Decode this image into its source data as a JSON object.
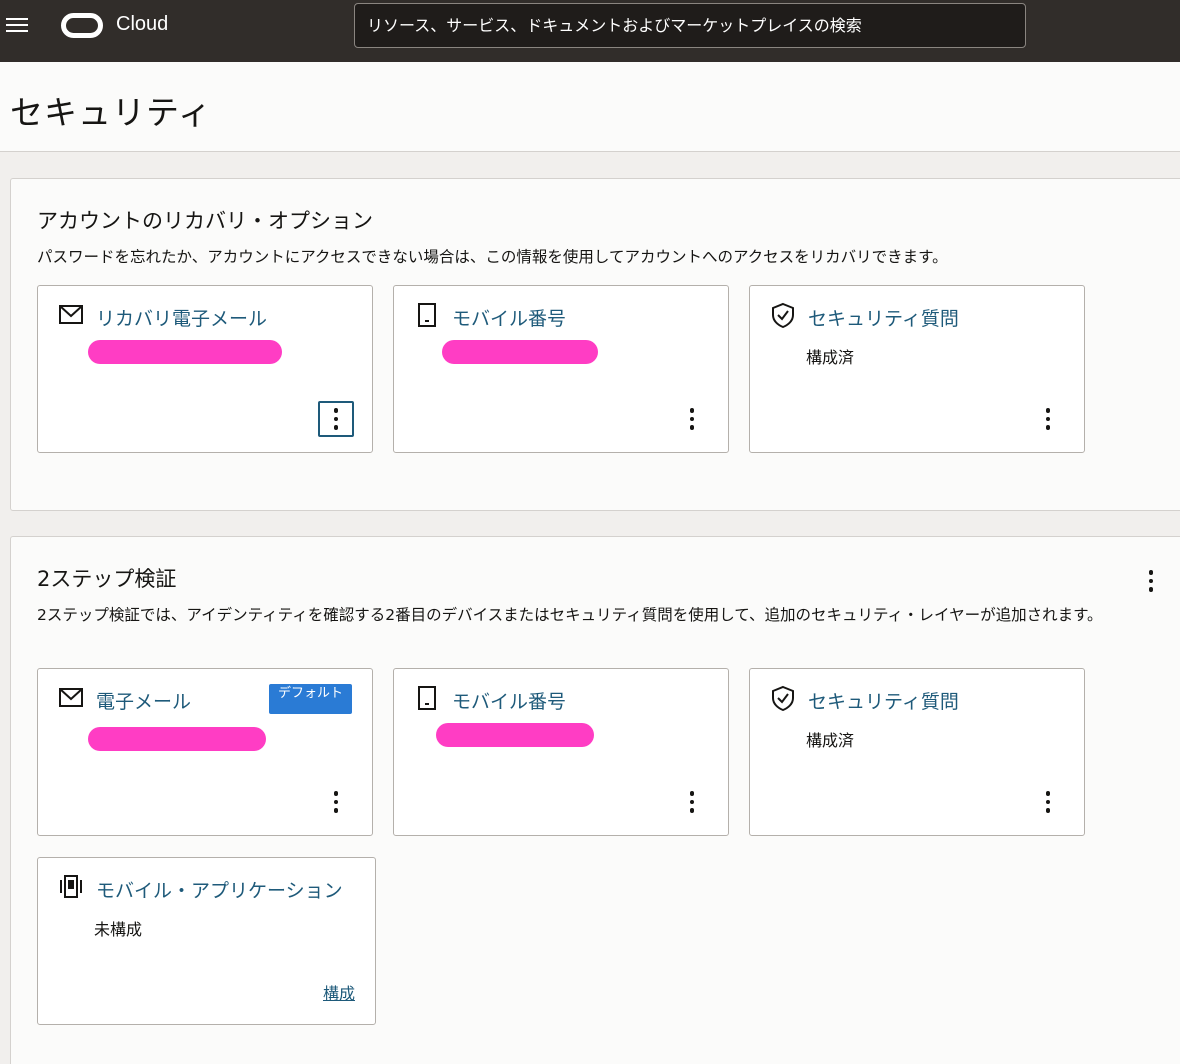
{
  "header": {
    "brand": "Cloud",
    "search_placeholder": "リソース、サービス、ドキュメントおよびマーケットプレイスの検索"
  },
  "page": {
    "title": "セキュリティ"
  },
  "recovery": {
    "title": "アカウントのリカバリ・オプション",
    "description": "パスワードを忘れたか、アカウントにアクセスできない場合は、この情報を使用してアカウントへのアクセスをリカバリできます。",
    "cards": [
      {
        "title": "リカバリ電子メール",
        "icon": "mail-icon"
      },
      {
        "title": "モバイル番号",
        "icon": "mobile-icon"
      },
      {
        "title": "セキュリティ質問",
        "status": "構成済",
        "icon": "shield-check-icon"
      }
    ]
  },
  "two_step": {
    "title": "2ステップ検証",
    "description": "2ステップ検証では、アイデンティティを確認する2番目のデバイスまたはセキュリティ質問を使用して、追加のセキュリティ・レイヤーが追加されます。",
    "cards": [
      {
        "title": "電子メール",
        "badge": "デフォルト",
        "icon": "mail-icon"
      },
      {
        "title": "モバイル番号",
        "icon": "mobile-icon"
      },
      {
        "title": "セキュリティ質問",
        "status": "構成済",
        "icon": "shield-check-icon"
      },
      {
        "title": "モバイル・アプリケーション",
        "status": "未構成",
        "action": "構成",
        "icon": "mobile-app-icon"
      }
    ]
  },
  "colors": {
    "topbar": "#312d2a",
    "link": "#1e5a7a",
    "badge": "#2a7bd5",
    "redaction": "#ff3dc4"
  }
}
